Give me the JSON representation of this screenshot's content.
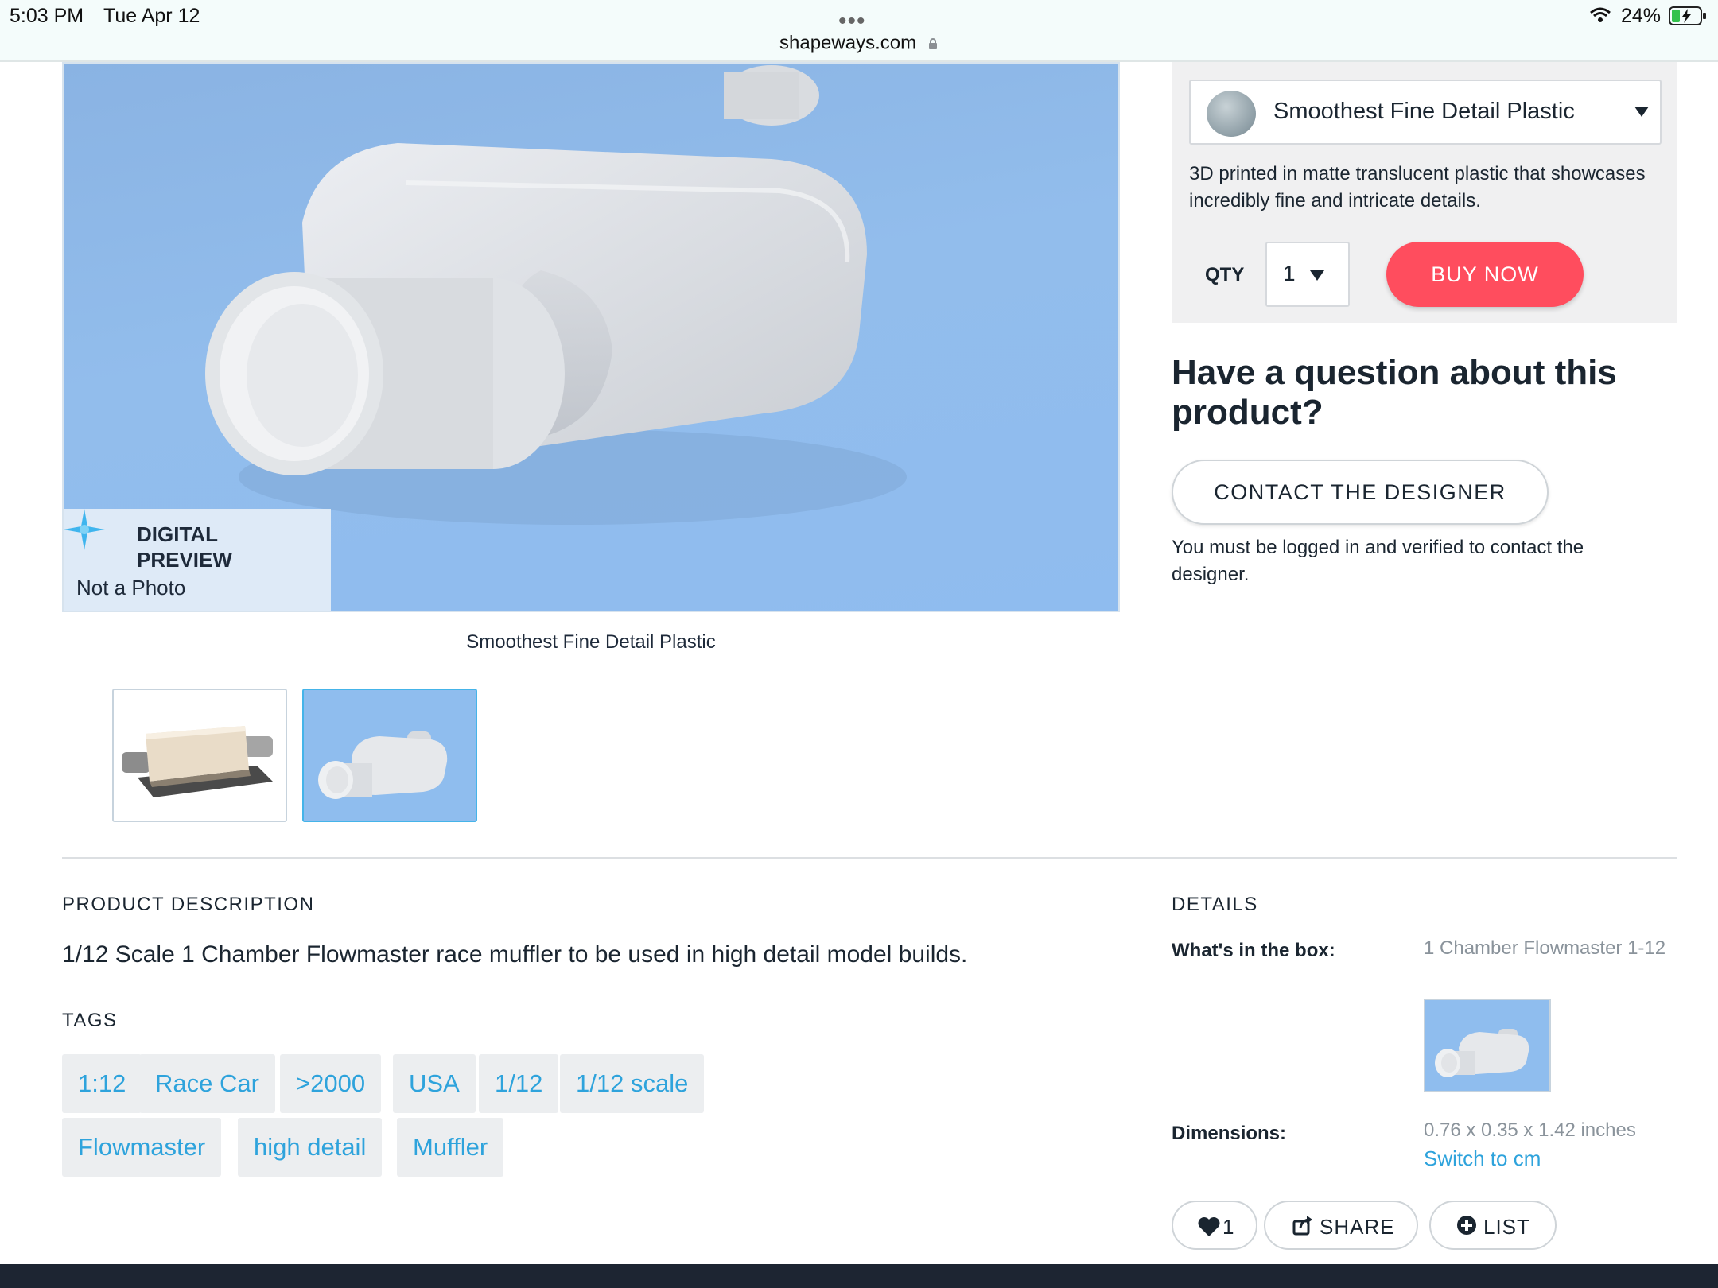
{
  "status_bar": {
    "time": "5:03 PM",
    "day": "Tue Apr 12",
    "dots": "•••",
    "url": "shapeways.com",
    "battery": "24%"
  },
  "preview": {
    "title": "DIGITAL PREVIEW",
    "subtitle": "Not a Photo",
    "caption": "Smoothest Fine Detail Plastic"
  },
  "purchase": {
    "material": "Smoothest Fine Detail Plastic",
    "material_description": "3D printed in matte translucent plastic that showcases incredibly fine and intricate details.",
    "qty_label": "QTY",
    "qty_value": "1",
    "buy_label": "BUY NOW"
  },
  "question": {
    "heading": "Have a question about this product?",
    "contact_label": "CONTACT THE DESIGNER",
    "note": "You must be logged in and verified to contact the designer."
  },
  "description": {
    "label": "PRODUCT DESCRIPTION",
    "text": "1/12 Scale 1 Chamber Flowmaster race muffler to be used in high detail model builds.",
    "tags_label": "TAGS",
    "tags": [
      "1:12",
      "Race Car",
      ">2000",
      "USA",
      "1/12",
      "1/12 scale",
      "Flowmaster",
      "high detail",
      "Muffler"
    ]
  },
  "details": {
    "label": "DETAILS",
    "box_key": "What's in the box:",
    "box_value": "1 Chamber Flowmaster 1-12",
    "dimensions_key": "Dimensions:",
    "dimensions_value": "0.76 x 0.35 x 1.42 inches",
    "switch_label": "Switch to cm"
  },
  "actions": {
    "like_count": "1",
    "share_label": "SHARE",
    "list_label": "LIST"
  },
  "colors": {
    "accent": "#2ea3dc",
    "buy": "#ff4d5e",
    "image_bg": "#8fbdee"
  },
  "icons": [
    "lock-icon",
    "wifi-icon",
    "battery-icon",
    "sparkle-icon",
    "caret-down-icon",
    "heart-icon",
    "share-icon",
    "plus-circle-icon"
  ]
}
